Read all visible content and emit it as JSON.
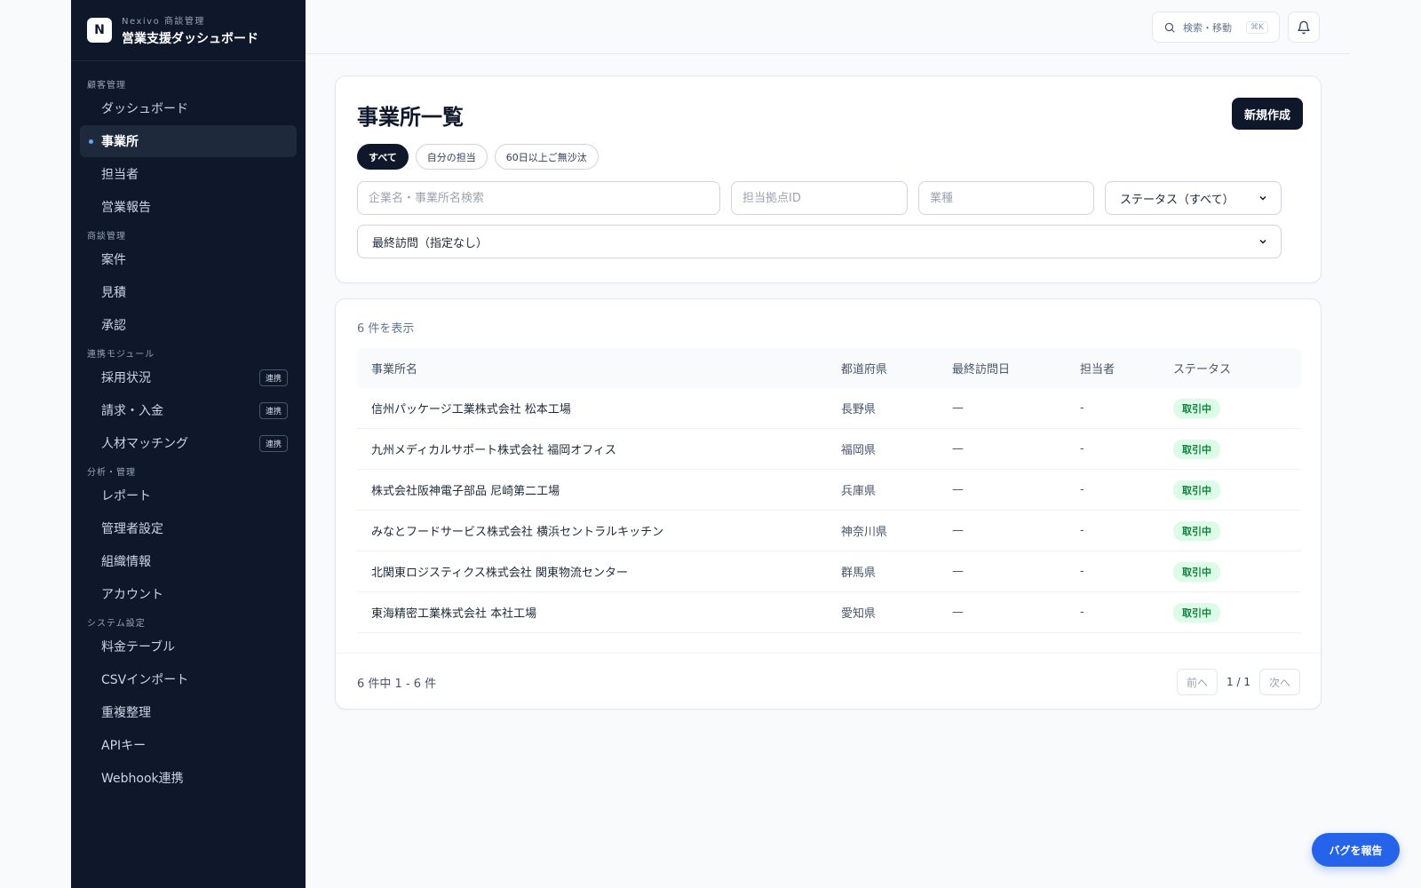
{
  "brand": {
    "logo": "N",
    "subtitle": "Nexivo 商談管理",
    "title": "営業支援ダッシュボード"
  },
  "sidebar": {
    "sections": [
      {
        "label": "顧客管理",
        "items": [
          {
            "label": "ダッシュボード"
          },
          {
            "label": "事業所",
            "active": true
          },
          {
            "label": "担当者"
          },
          {
            "label": "営業報告"
          }
        ]
      },
      {
        "label": "商談管理",
        "items": [
          {
            "label": "案件"
          },
          {
            "label": "見積"
          },
          {
            "label": "承認"
          }
        ]
      },
      {
        "label": "連携モジュール",
        "items": [
          {
            "label": "採用状況",
            "badge": "連携"
          },
          {
            "label": "請求・入金",
            "badge": "連携"
          },
          {
            "label": "人材マッチング",
            "badge": "連携"
          }
        ]
      },
      {
        "label": "分析・管理",
        "items": [
          {
            "label": "レポート"
          },
          {
            "label": "管理者設定"
          },
          {
            "label": "組織情報"
          },
          {
            "label": "アカウント"
          }
        ]
      },
      {
        "label": "システム設定",
        "items": [
          {
            "label": "料金テーブル"
          },
          {
            "label": "CSVインポート"
          },
          {
            "label": "重複整理"
          },
          {
            "label": "APIキー"
          },
          {
            "label": "Webhook連携"
          }
        ]
      }
    ]
  },
  "topbar": {
    "search_label": "検索・移動",
    "search_shortcut": "⌘K",
    "bell_icon": "bell-icon"
  },
  "page": {
    "title": "事業所一覧",
    "new_button": "新規作成",
    "chips": [
      "すべて",
      "自分の担当",
      "60日以上ご無沙汰"
    ],
    "filters": {
      "company_placeholder": "企業名・事業所名検索",
      "branch_placeholder": "担当拠点ID",
      "industry_placeholder": "業種",
      "status_value": "ステータス（すべて）",
      "last_visit_value": "最終訪問（指定なし）"
    }
  },
  "table": {
    "count_text": "6 件を表示",
    "headers": [
      "事業所名",
      "都道府県",
      "最終訪問日",
      "担当者",
      "ステータス"
    ],
    "rows": [
      [
        "信州パッケージ工業株式会社 松本工場",
        "長野県",
        "—",
        "-",
        "取引中"
      ],
      [
        "九州メディカルサポート株式会社 福岡オフィス",
        "福岡県",
        "—",
        "-",
        "取引中"
      ],
      [
        "株式会社阪神電子部品 尼崎第二工場",
        "兵庫県",
        "—",
        "-",
        "取引中"
      ],
      [
        "みなとフードサービス株式会社 横浜セントラルキッチン",
        "神奈川県",
        "—",
        "-",
        "取引中"
      ],
      [
        "北関東ロジスティクス株式会社 関東物流センター",
        "群馬県",
        "—",
        "-",
        "取引中"
      ],
      [
        "東海精密工業株式会社 本社工場",
        "愛知県",
        "—",
        "-",
        "取引中"
      ]
    ],
    "range_text": "6 件中 1 - 6 件",
    "prev": "前へ",
    "page_indicator": "1 / 1",
    "next": "次へ"
  },
  "bug_button": "バグを報告",
  "colors": {
    "sidebar_bg": "#0f172a",
    "accent": "#2563eb",
    "status_bg": "#dcfce7",
    "status_fg": "#15803d"
  }
}
